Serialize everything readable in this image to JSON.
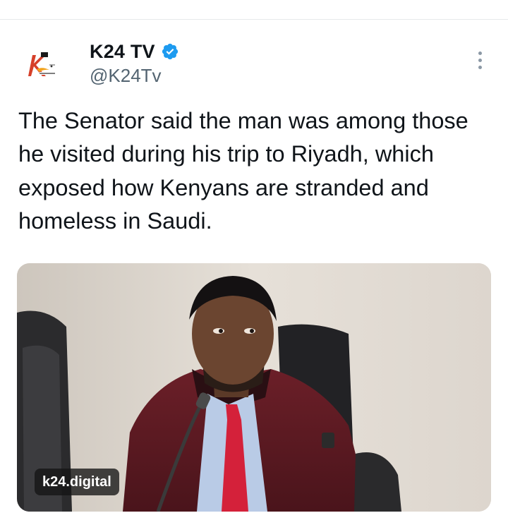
{
  "tweet": {
    "author": {
      "display_name": "K24 TV",
      "handle": "@K24Tv",
      "verified": true,
      "avatar_icon": "k24-digital-logo-icon"
    },
    "text": "The Senator said the man was among those he visited during his trip to Riyadh, which exposed how Kenyans are stranded and homeless in Saudi.",
    "media": {
      "watermark": "k24.digital"
    },
    "more_icon": "more-options-icon"
  },
  "colors": {
    "verified_blue": "#1d9bf0",
    "secondary_text": "#536471",
    "primary_text": "#0f1419"
  }
}
